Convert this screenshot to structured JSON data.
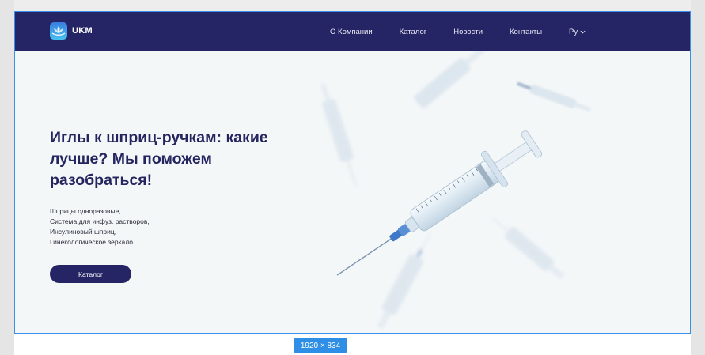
{
  "brand": {
    "name": "UKM"
  },
  "nav": {
    "items": [
      {
        "label": "О Компании"
      },
      {
        "label": "Каталог"
      },
      {
        "label": "Новости"
      },
      {
        "label": "Контакты"
      }
    ],
    "lang": "Ру"
  },
  "hero": {
    "title": "Иглы к шприц-ручкам: какие лучше? Мы поможем разобраться!",
    "list": [
      "Шприцы одноразовые,",
      "Система для инфуз. растворов,",
      "Инсулиновый шприц,",
      "Гинекологическое зеркало"
    ],
    "cta": "Каталог"
  },
  "frame_badge": "1920 × 834",
  "colors": {
    "navy": "#252565",
    "accent": "#3a8fe8",
    "hero_bg": "#f4f7f8"
  }
}
